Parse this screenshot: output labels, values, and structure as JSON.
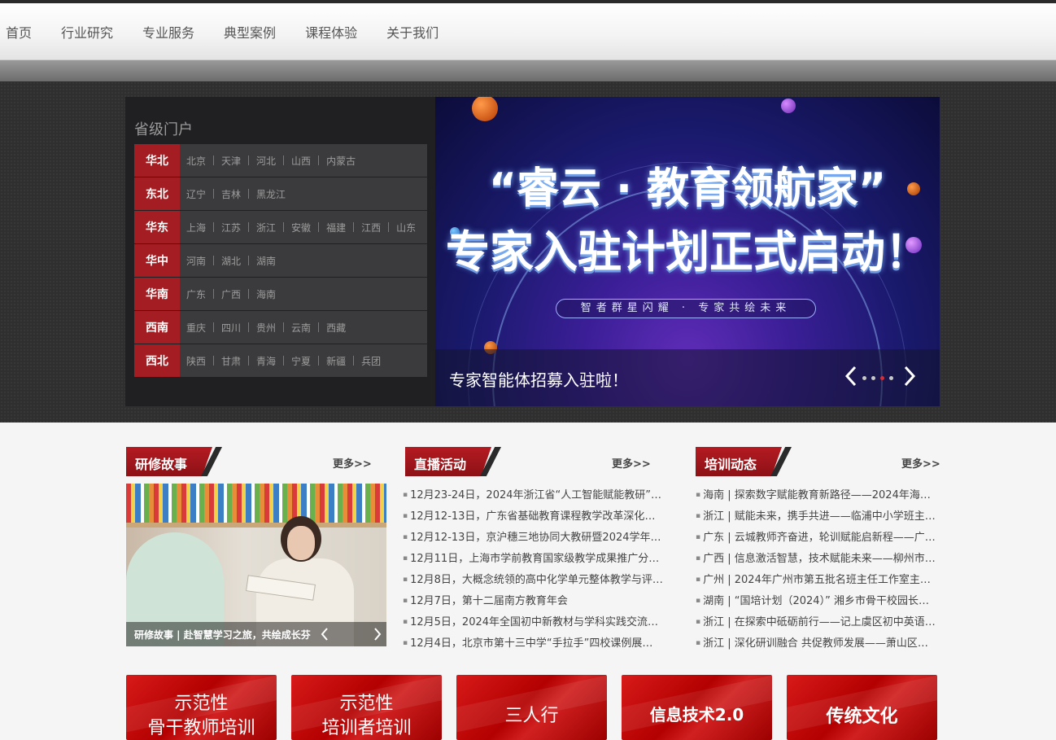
{
  "nav": {
    "items": [
      "首页",
      "行业研究",
      "专业服务",
      "典型案例",
      "课程体验",
      "关于我们"
    ]
  },
  "portal": {
    "title": "省级门户",
    "regions": [
      {
        "name": "华北",
        "cities": [
          "北京",
          "天津",
          "河北",
          "山西",
          "内蒙古"
        ]
      },
      {
        "name": "东北",
        "cities": [
          "辽宁",
          "吉林",
          "黑龙江"
        ]
      },
      {
        "name": "华东",
        "cities": [
          "上海",
          "江苏",
          "浙江",
          "安徽",
          "福建",
          "江西",
          "山东"
        ]
      },
      {
        "name": "华中",
        "cities": [
          "河南",
          "湖北",
          "湖南"
        ]
      },
      {
        "name": "华南",
        "cities": [
          "广东",
          "广西",
          "海南"
        ]
      },
      {
        "name": "西南",
        "cities": [
          "重庆",
          "四川",
          "贵州",
          "云南",
          "西藏"
        ]
      },
      {
        "name": "西北",
        "cities": [
          "陕西",
          "甘肃",
          "青海",
          "宁夏",
          "新疆",
          "兵团"
        ]
      }
    ]
  },
  "banner": {
    "line1": "“睿云 · 教育领航家”",
    "line2": "专家入驻计划正式启动！",
    "pill": "智者群星闪耀 · 专家共绘未来",
    "caption": "专家智能体招募入驻啦！",
    "slide_count": 4,
    "active_slide": 3,
    "colors": {
      "accent_dot": "#d0303a"
    }
  },
  "sections": {
    "stories": {
      "title": "研修故事",
      "more": "更多>>",
      "caption": "研修故事 | 赴智慧学习之旅，共绘成长芬"
    },
    "live": {
      "title": "直播活动",
      "more": "更多>>",
      "items": [
        "12月23-24日，2024年浙江省“人工智能赋能教研”…",
        "12月12-13日，广东省基础教育课程教学改革深化行…",
        "12月12-13日，京沪穗三地协同大教研暨2024学年第…",
        "12月11日，上海市学前教育国家级教学成果推广分…",
        "12月8日，大概念统领的高中化学单元整体教学与评…",
        "12月7日，第十二届南方教育年会",
        "12月5日，2024年全国初中新教材与学科实践交流研…",
        "12月4日，北京市第十三中学“手拉手”四校课例展…"
      ]
    },
    "training": {
      "title": "培训动态",
      "more": "更多>>",
      "items": [
        "海南 | 探索数字赋能教育新路径——2024年海南…",
        "浙江 | 赋能未来，携手共进——临浦中小学班主…",
        "广东 | 云城教师齐奋进，轮训赋能启新程——广…",
        "广西 | 信息激活智慧，技术赋能未来——柳州市…",
        "广州 | 2024年广州市第五批名班主任工作室主持…",
        "湖南 | “国培计划（2024）” 湘乡市骨干校园长…",
        "浙江 | 在探索中砥砺前行——记上虞区初中英语…",
        "浙江 | 深化研训融合 共促教师发展——萧山区研…"
      ]
    }
  },
  "programs": [
    {
      "line1": "示范性",
      "line2": "骨干教师培训"
    },
    {
      "line1": "示范性",
      "line2": "培训者培训"
    },
    {
      "line1": "三人行",
      "line2": ""
    },
    {
      "line1": "信息技术2.0",
      "line2": ""
    },
    {
      "line1": "传统文化",
      "line2": ""
    }
  ],
  "colors": {
    "brand_red": "#a41d22",
    "portal_bg": "#202022",
    "region_row_bg": "#3b3b3d"
  }
}
